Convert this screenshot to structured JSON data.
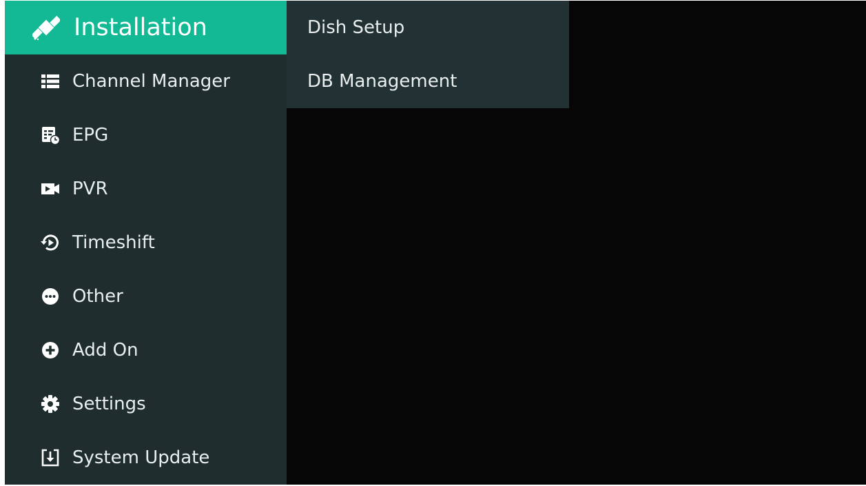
{
  "colors": {
    "screen_background": "#060606",
    "sidebar_background": "#1f2d2e",
    "submenu_background": "#223234",
    "active_item": "#13b994",
    "text": "#e9eeee"
  },
  "sidebar": {
    "items": [
      {
        "label": "Installation",
        "icon": "satellite-icon",
        "active": true
      },
      {
        "label": "Channel Manager",
        "icon": "list-icon",
        "active": false
      },
      {
        "label": "EPG",
        "icon": "epg-schedule-icon",
        "active": false
      },
      {
        "label": "PVR",
        "icon": "video-camera-icon",
        "active": false
      },
      {
        "label": "Timeshift",
        "icon": "timeshift-icon",
        "active": false
      },
      {
        "label": "Other",
        "icon": "more-dots-icon",
        "active": false
      },
      {
        "label": "Add On",
        "icon": "plus-circle-icon",
        "active": false
      },
      {
        "label": "Settings",
        "icon": "gear-icon",
        "active": false
      },
      {
        "label": "System Update",
        "icon": "download-box-icon",
        "active": false
      }
    ]
  },
  "submenu": {
    "items": [
      {
        "label": "Dish Setup"
      },
      {
        "label": "DB Management"
      }
    ]
  }
}
